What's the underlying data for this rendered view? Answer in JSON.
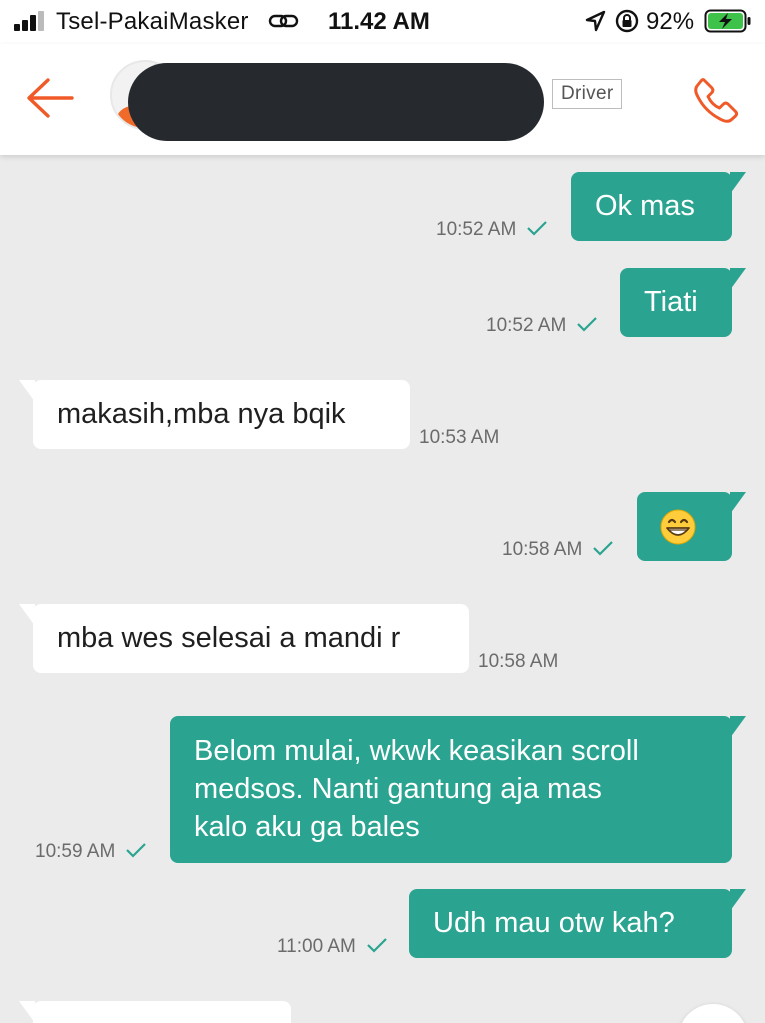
{
  "status_bar": {
    "carrier": "Tsel-PakaiMasker",
    "time": "11.42 AM",
    "battery": "92%"
  },
  "header": {
    "role_badge": "Driver"
  },
  "colors": {
    "accent": "#f05a28",
    "outgoing_bubble": "#2aa490",
    "incoming_bubble": "#ffffff",
    "background": "#ebebeb"
  },
  "messages": [
    {
      "direction": "out",
      "text": "Ok mas",
      "time": "10:52 AM",
      "read": true
    },
    {
      "direction": "out",
      "text": "Tiati",
      "time": "10:52 AM",
      "read": true
    },
    {
      "direction": "in",
      "text": "makasih,mba nya bqik",
      "time": "10:53 AM"
    },
    {
      "direction": "out",
      "text": "😁",
      "emoji": "grinning-face-with-smiling-eyes",
      "time": "10:58 AM",
      "read": true
    },
    {
      "direction": "in",
      "text": "mba wes selesai a mandi r",
      "time": "10:58 AM"
    },
    {
      "direction": "out",
      "lines": [
        "Belom mulai, wkwk keasikan scroll",
        "medsos. Nanti gantung aja mas",
        "kalo aku ga bales"
      ],
      "time": "10:59 AM",
      "read": true
    },
    {
      "direction": "out",
      "text": "Udh mau otw kah?",
      "time": "11:00 AM",
      "read": true
    }
  ]
}
